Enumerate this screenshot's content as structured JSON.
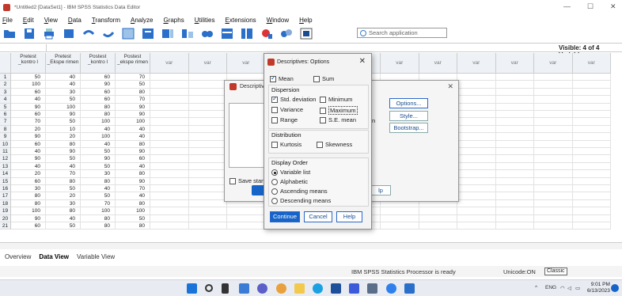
{
  "window": {
    "title": "*Untitled2 [DataSet1] - IBM SPSS Statistics Data Editor",
    "minimize": "—",
    "maximize": "☐",
    "close": "✕"
  },
  "menu": [
    "File",
    "Edit",
    "View",
    "Data",
    "Transform",
    "Analyze",
    "Graphs",
    "Utilities",
    "Extensions",
    "Window",
    "Help"
  ],
  "search": {
    "placeholder": "Search application"
  },
  "visible": "Visible: 4 of 4 Variable",
  "columns": [
    {
      "label": "Pretest _kontro l"
    },
    {
      "label": "Pretest _Ekspe rimen"
    },
    {
      "label": "Postest _kontro l"
    },
    {
      "label": "Postest _ekspe rimen"
    }
  ],
  "var_label": "var",
  "rows": [
    [
      "50",
      "40",
      "60",
      "70"
    ],
    [
      "100",
      "40",
      "90",
      "50"
    ],
    [
      "60",
      "30",
      "60",
      "80"
    ],
    [
      "40",
      "50",
      "60",
      "70"
    ],
    [
      "90",
      "100",
      "80",
      "90"
    ],
    [
      "60",
      "90",
      "80",
      "90"
    ],
    [
      "70",
      "50",
      "100",
      "100"
    ],
    [
      "20",
      "10",
      "40",
      "40"
    ],
    [
      "90",
      "20",
      "100",
      "40"
    ],
    [
      "60",
      "80",
      "40",
      "80"
    ],
    [
      "40",
      "90",
      "50",
      "90"
    ],
    [
      "90",
      "50",
      "90",
      "60"
    ],
    [
      "40",
      "40",
      "50",
      "40"
    ],
    [
      "20",
      "70",
      "30",
      "80"
    ],
    [
      "60",
      "80",
      "80",
      "90"
    ],
    [
      "30",
      "50",
      "40",
      "70"
    ],
    [
      "80",
      "20",
      "50",
      "40"
    ],
    [
      "80",
      "30",
      "70",
      "80"
    ],
    [
      "100",
      "80",
      "100",
      "100"
    ],
    [
      "90",
      "40",
      "80",
      "50"
    ],
    [
      "60",
      "50",
      "80",
      "80"
    ]
  ],
  "tabs": {
    "overview": "Overview",
    "data_view": "Data View",
    "variable_view": "Variable View"
  },
  "status": {
    "processor": "IBM SPSS Statistics Processor is ready",
    "unicode": "Unicode:ON",
    "classic": "Classic"
  },
  "clock": {
    "time": "9:01 PM",
    "date": "6/13/2023",
    "lang": "ENG"
  },
  "descriptives": {
    "title": "Descriptives",
    "save_label": "Save standardiz",
    "partial_n": "n",
    "buttons": {
      "options": "Options...",
      "style": "Style...",
      "bootstrap": "Bootstrap...",
      "help_partial": "lp"
    }
  },
  "options": {
    "title": "Descriptives: Options",
    "mean": "Mean",
    "sum": "Sum",
    "dispersion": "Dispersion",
    "std_dev": "Std. deviation",
    "minimum": "Minimum",
    "variance": "Variance",
    "maximum": "Maximum",
    "range": "Range",
    "se_mean": "S.E. mean",
    "distribution": "Distribution",
    "kurtosis": "Kurtosis",
    "skewness": "Skewness",
    "display_order": "Display Order",
    "variable_list": "Variable list",
    "alphabetic": "Alphabetic",
    "ascending": "Ascending means",
    "descending": "Descending means",
    "continue": "Continue",
    "cancel": "Cancel",
    "help": "Help"
  },
  "colors": {
    "accent": "#1664c7",
    "header_bg": "#eef1f5"
  }
}
